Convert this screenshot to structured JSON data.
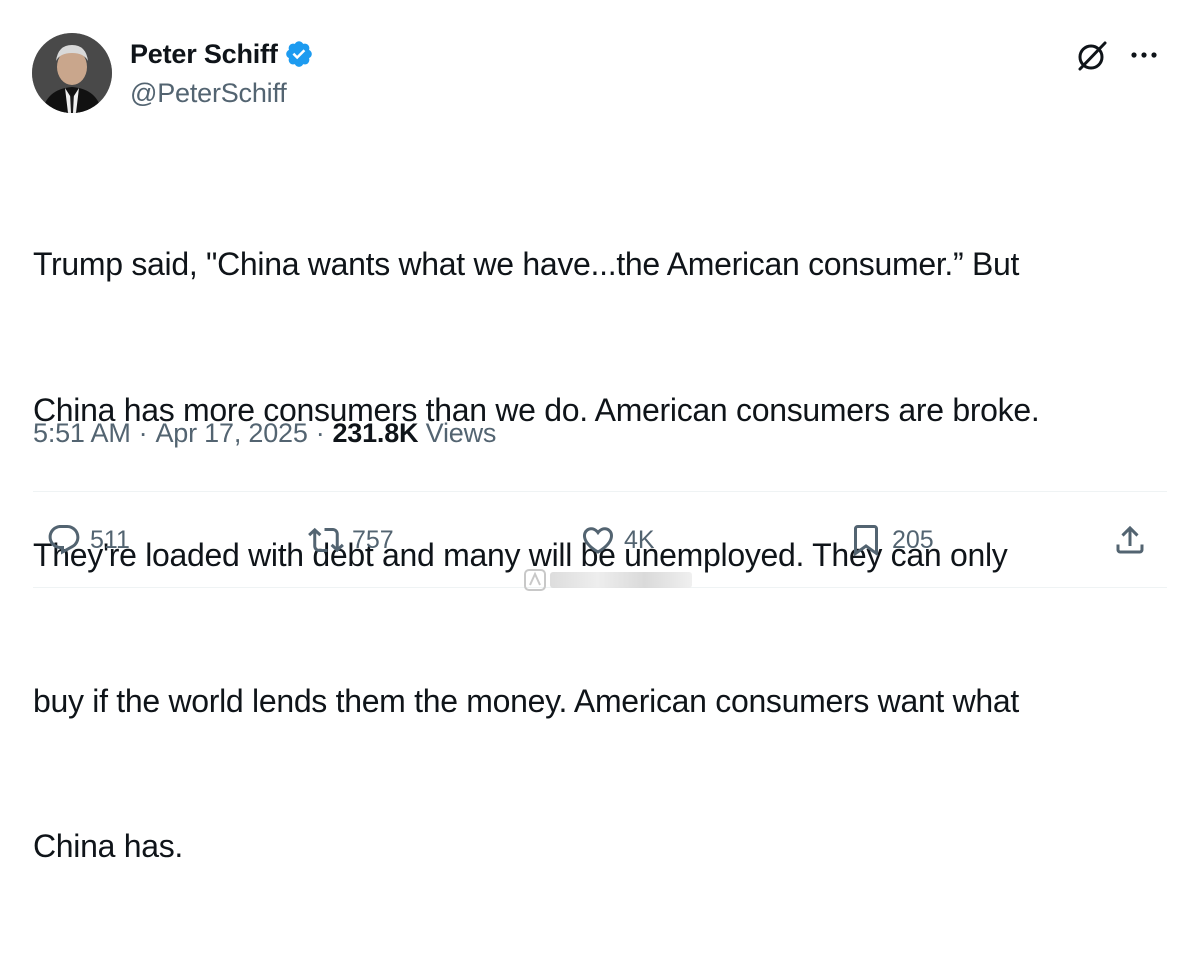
{
  "author": {
    "display_name": "Peter Schiff",
    "handle": "@PeterSchiff",
    "verified": true,
    "avatar_icon": "profile-photo"
  },
  "tweet": {
    "text_lines": [
      "Trump said, \"China wants what we have...the American consumer.” But",
      "China has more consumers than we do. American consumers are broke.",
      "They're loaded with debt and many will be unemployed. They can only",
      "buy if the world lends them the money. American consumers want what",
      "China has."
    ]
  },
  "meta": {
    "time": "5:51 AM",
    "separator": "·",
    "date": "Apr 17, 2025",
    "views_count": "231.8K",
    "views_label": "Views"
  },
  "actions": {
    "reply_count": "511",
    "retweet_count": "757",
    "like_count": "4K",
    "bookmark_count": "205"
  },
  "icons": {
    "verified": "verified-badge-icon",
    "grok": "grok-icon",
    "more": "more-icon",
    "reply": "reply-icon",
    "retweet": "retweet-icon",
    "like": "heart-icon",
    "bookmark": "bookmark-icon",
    "share": "share-icon"
  },
  "colors": {
    "text_primary": "#0f1419",
    "text_secondary": "#536471",
    "verified_blue": "#1d9bf0",
    "divider": "#eff3f4"
  }
}
